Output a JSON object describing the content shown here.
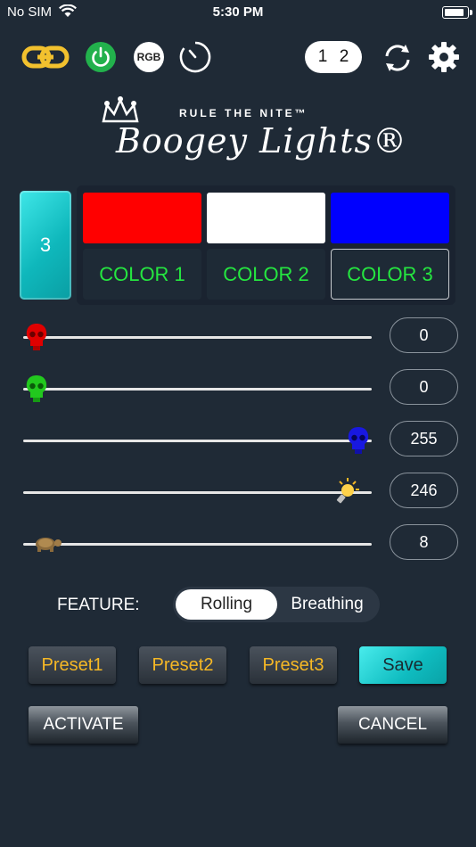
{
  "status_bar": {
    "carrier": "No SIM",
    "time": "5:30 PM"
  },
  "toolbar": {
    "rgb_label": "RGB",
    "zone_left": "1",
    "zone_right": "2",
    "icons": [
      "link-icon",
      "power-icon",
      "rgb-icon",
      "timer-icon",
      "sync-icon",
      "gear-icon"
    ]
  },
  "logo": {
    "tagline": "RULE THE NITE™",
    "name": "Boogey Lights®"
  },
  "zone_card": {
    "number": "3"
  },
  "colors": [
    {
      "label": "COLOR 1",
      "swatch": "#ff0000",
      "selected": false
    },
    {
      "label": "COLOR 2",
      "swatch": "#ffffff",
      "selected": false
    },
    {
      "label": "COLOR 3",
      "swatch": "#0000ff",
      "selected": true
    }
  ],
  "sliders": [
    {
      "channel": "red",
      "value": "0",
      "level": 0,
      "icon": "red-skull-icon"
    },
    {
      "channel": "green",
      "value": "0",
      "level": 0,
      "icon": "green-skull-icon"
    },
    {
      "channel": "blue",
      "value": "255",
      "level": 255,
      "icon": "blue-skull-icon"
    },
    {
      "channel": "brightness",
      "value": "246",
      "level": 246,
      "icon": "lightbulb-icon"
    },
    {
      "channel": "speed",
      "value": "8",
      "level": 8,
      "icon": "turtle-icon"
    }
  ],
  "feature": {
    "label": "FEATURE:",
    "options": [
      "Rolling",
      "Breathing"
    ],
    "selected": "Rolling"
  },
  "presets": [
    "Preset1",
    "Preset2",
    "Preset3"
  ],
  "save_label": "Save",
  "activate_label": "ACTIVATE",
  "cancel_label": "CANCEL",
  "accent_colors": {
    "cyan": "#13c3c6",
    "green": "#25e640",
    "gold": "#f6b825",
    "background": "#1f2a36"
  }
}
